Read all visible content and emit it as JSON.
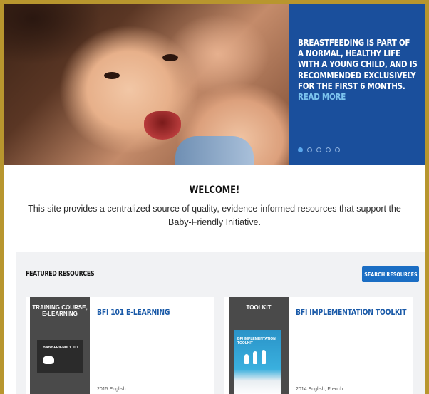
{
  "hero": {
    "text": "Breastfeeding is part of a normal, healthy life with a young child, and is recommended exclusively for the first 6 months.",
    "read_more": "READ MORE",
    "slide_count": 5,
    "active_slide": 1
  },
  "welcome": {
    "title": "WELCOME!",
    "body": "This site provides a centralized source of quality, evidence-informed resources that support the Baby-Friendly Initiative."
  },
  "featured": {
    "title": "FEATURED RESOURCES",
    "search_button": "SEARCH RESOURCES",
    "cards": [
      {
        "type": "TRAINING COURSE, E-LEARNING",
        "title": "BFI 101 E-LEARNING",
        "meta": "2015 English",
        "thumb_label": "BABY-FRIENDLY 101"
      },
      {
        "type": "TOOLKIT",
        "title": "BFI IMPLEMENTATION TOOLKIT",
        "meta": "2014 English, French",
        "thumb_label": "BFI IMPLEMENTATION TOOLKIT"
      }
    ]
  },
  "colors": {
    "frame": "#b8962e",
    "hero_panel": "#1a4f9c",
    "accent": "#1b6ec4",
    "link": "#1a5aa8"
  }
}
